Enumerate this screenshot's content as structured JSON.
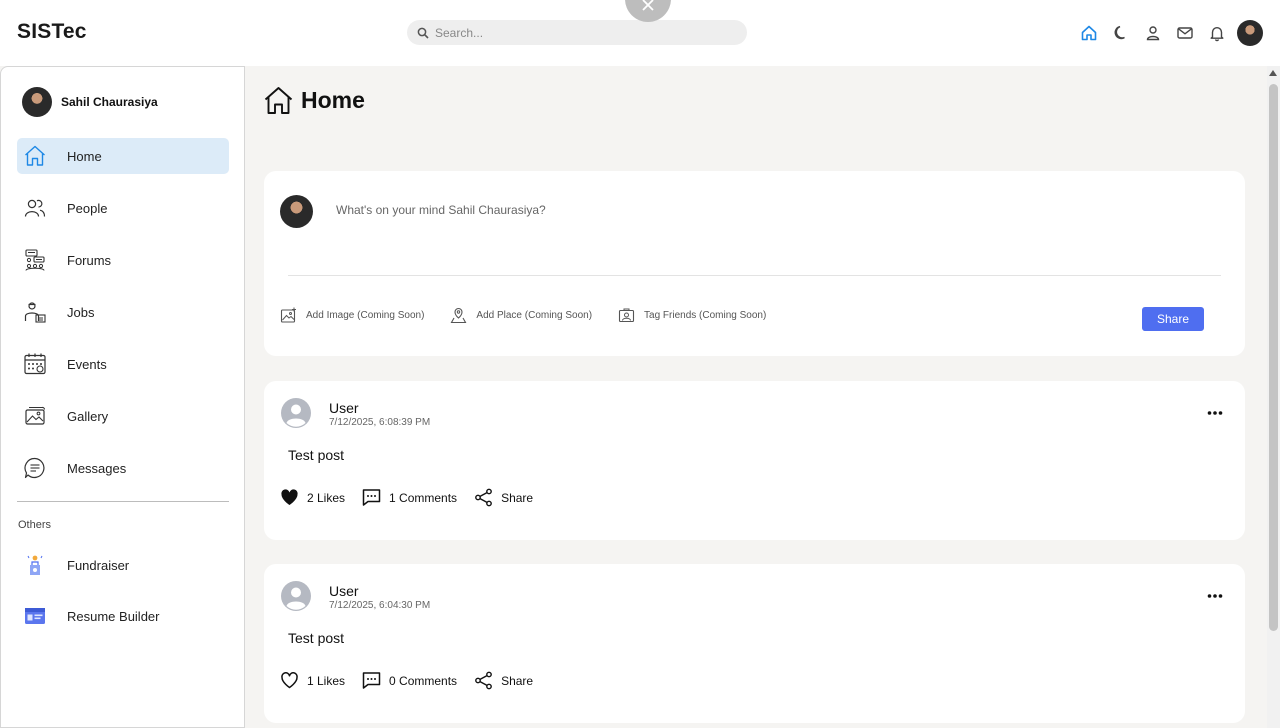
{
  "app": {
    "brand": "SISTec"
  },
  "search": {
    "placeholder": "Search..."
  },
  "topbar": {
    "icons": [
      "home-icon",
      "moon-icon",
      "person-icon",
      "mail-icon",
      "bell-icon",
      "avatar"
    ],
    "active_color": "#1e88e5"
  },
  "user": {
    "name": "Sahil Chaurasiya"
  },
  "sidebar": {
    "items": [
      {
        "label": "Home",
        "icon": "home-icon",
        "active": true
      },
      {
        "label": "People",
        "icon": "people-icon"
      },
      {
        "label": "Forums",
        "icon": "forums-icon"
      },
      {
        "label": "Jobs",
        "icon": "jobs-icon"
      },
      {
        "label": "Events",
        "icon": "calendar-icon"
      },
      {
        "label": "Gallery",
        "icon": "gallery-icon"
      },
      {
        "label": "Messages",
        "icon": "messages-icon"
      }
    ],
    "others_label": "Others",
    "others": [
      {
        "label": "Fundraiser",
        "icon": "fundraiser-icon"
      },
      {
        "label": "Resume Builder",
        "icon": "resume-icon"
      }
    ]
  },
  "page": {
    "title": "Home"
  },
  "composer": {
    "placeholder": "What's on your mind Sahil Chaurasiya?",
    "actions": [
      {
        "label": "Add Image (Coming Soon)",
        "icon": "image-icon"
      },
      {
        "label": "Add Place (Coming Soon)",
        "icon": "place-icon"
      },
      {
        "label": "Tag Friends (Coming Soon)",
        "icon": "tag-icon"
      }
    ],
    "share_label": "Share",
    "share_color": "#4f6ef0"
  },
  "posts": [
    {
      "user": "User",
      "time": "7/12/2025, 6:08:39 PM",
      "body": "Test post",
      "likes": "2 Likes",
      "comments": "1 Comments",
      "share": "Share",
      "liked": true
    },
    {
      "user": "User",
      "time": "7/12/2025, 6:04:30 PM",
      "body": "Test post",
      "likes": "1 Likes",
      "comments": "0 Comments",
      "share": "Share",
      "liked": false
    }
  ]
}
